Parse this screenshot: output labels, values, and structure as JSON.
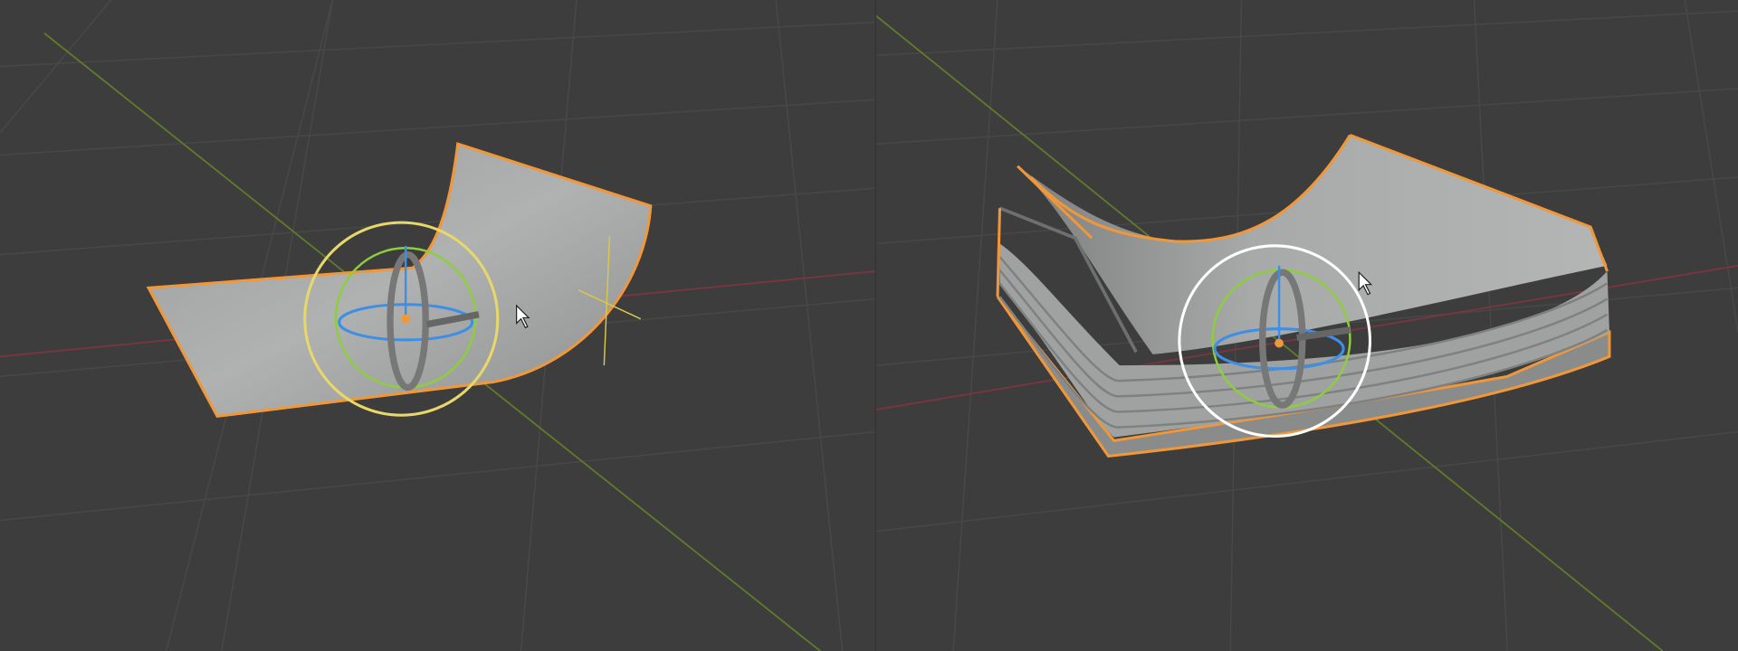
{
  "viewports": [
    {
      "name": "left-viewport",
      "object": "curved-sheet",
      "gizmo": "rotate"
    },
    {
      "name": "right-viewport",
      "object": "stacked-curved-sheets",
      "gizmo": "rotate"
    }
  ],
  "colors": {
    "background": "#3d3d3d",
    "grid": "#4a4a4a",
    "x_axis": "#8a3a44",
    "y_axis": "#6b8a2e",
    "selection_outline": "#f0973a",
    "mesh": "#a4a6a6",
    "gizmo_view": "#e8d86a",
    "gizmo_trackball": "#ffffff",
    "gizmo_z": "#3d8fe6",
    "gizmo_y": "#8ccf3a"
  }
}
